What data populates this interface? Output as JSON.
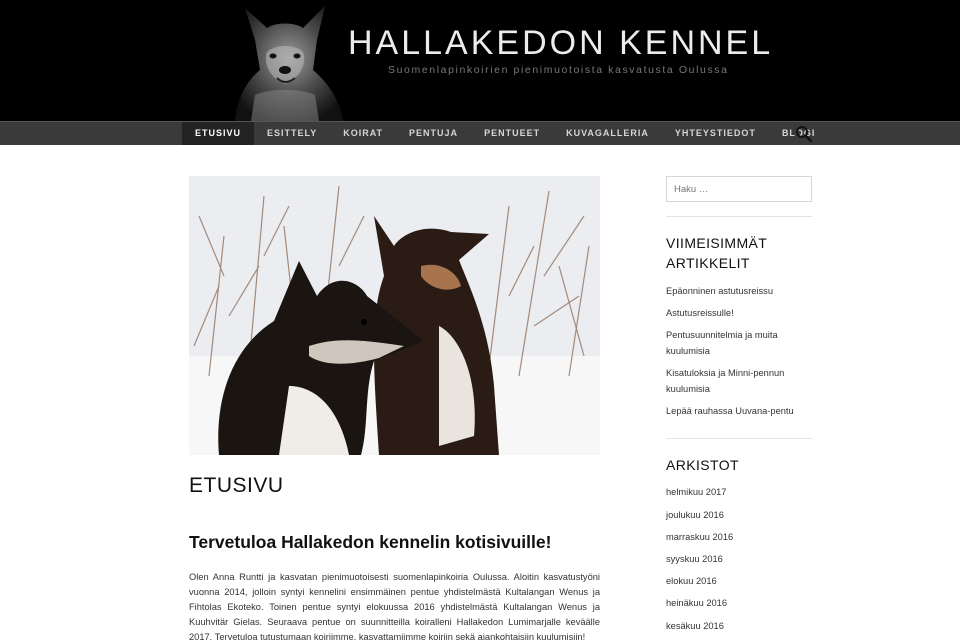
{
  "header": {
    "site_title": "HALLAKEDON KENNEL",
    "site_description": "Suomenlapinkoirien pienimuotoista kasvatusta Oulussa"
  },
  "nav": {
    "items": [
      {
        "label": "ETUSIVU",
        "active": true
      },
      {
        "label": "ESITTELY"
      },
      {
        "label": "KOIRAT"
      },
      {
        "label": "PENTUJA"
      },
      {
        "label": "PENTUEET"
      },
      {
        "label": "KUVAGALLERIA"
      },
      {
        "label": "YHTEYSTIEDOT"
      },
      {
        "label": "BLOGI"
      }
    ],
    "search_icon": "search-icon"
  },
  "main": {
    "page_title": "ETUSIVU",
    "post_heading": "Tervetuloa Hallakedon kennelin kotisivuille!",
    "intro_text": "Olen Anna Runtti ja kasvatan pienimuotoisesti suomenlapinkoiria Oulussa. Aloitin kasvatustyöni vuonna 2014, jolloin syntyi kennelini ensimmäinen pentue yhdistelmästä Kultalangan Wenus ja Fihtolas Ekoteko. Toinen pentue syntyi elokuussa 2016 yhdistelmästä Kultalangan Wenus ja Kuuhvitär Gielas. Seuraava pentue on suunnitteilla koiralleni Hallakedon Lumimarjalle keväälle 2017. Tervetuloa tutustumaan koiriimme, kasvattamiimme koiriin sekä ajankohtaisiin kuulumisiin!"
  },
  "sidebar": {
    "search_placeholder": "Haku …",
    "recent_title": "VIIMEISIMMÄT ARTIKKELIT",
    "recent": [
      "Epäonninen astutusreissu",
      "Astutusreissulle!",
      "Pentusuunnitelmia ja muita kuulumisia",
      "Kisatuloksia ja Minni-pennun kuulumisia",
      "Lepää rauhassa Uuvana-pentu"
    ],
    "archive_title": "ARKISTOT",
    "archives": [
      "helmikuu 2017",
      "joulukuu 2016",
      "marraskuu 2016",
      "syyskuu 2016",
      "elokuu 2016",
      "heinäkuu 2016",
      "kesäkuu 2016"
    ]
  },
  "colors": {
    "header_bg": "#000000",
    "nav_bg": "#3a3a3a",
    "nav_active_bg": "#232323"
  }
}
